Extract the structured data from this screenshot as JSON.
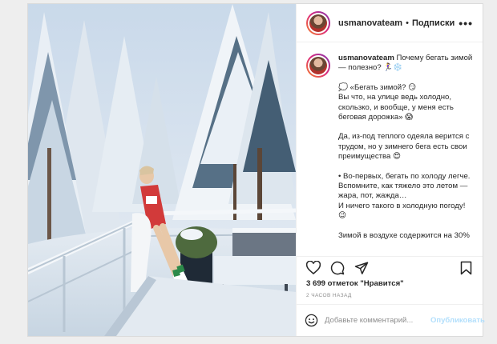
{
  "post": {
    "username": "usmanovateam",
    "follow_label": "Подписки",
    "more_label": "•••",
    "caption": {
      "username": "usmanovateam",
      "title": "Почему бегать зимой — полезно? 🏃‍♀️❄️",
      "paragraphs": [
        "💭 «Бегать зимой? 😏\nВы что, на улице ведь холодно, скользко, и вообще, у меня есть беговая дорожка» 😱",
        "Да, из-под теплого одеяла верится с трудом, но у зимнего бега есть свои преимущества 😍",
        "• Во-первых, бегать по холоду легче. Вспомните, как тяжело это летом — жара, пот, жажда…\nИ ничего такого в холодную погоду! 😉",
        "Зимой в воздухе содержится на 30%"
      ]
    },
    "likes": "3 699 отметок \"Нравится\"",
    "time": "2 ЧАСОВ НАЗАД",
    "comment": {
      "placeholder": "Добавьте комментарий...",
      "publish_label": "Опубликовать"
    }
  },
  "icons": {
    "like": "heart-icon",
    "comment": "comment-icon",
    "share": "paper-plane-icon",
    "save": "bookmark-icon",
    "emoji": "smiley-icon"
  }
}
